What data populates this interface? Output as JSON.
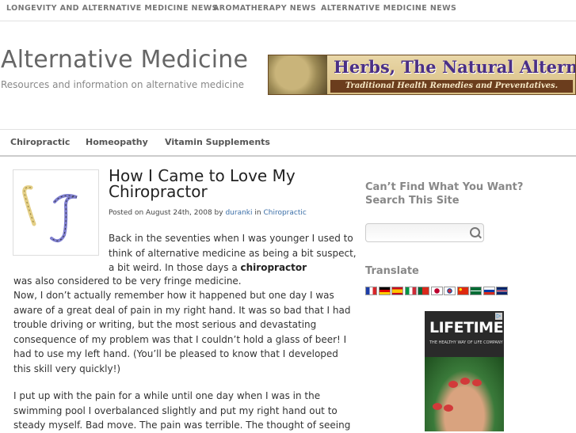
{
  "top_nav": [
    "LONGEVITY AND ALTERNATIVE MEDICINE NEWS",
    "AROMATHERAPY NEWS",
    "ALTERNATIVE MEDICINE NEWS"
  ],
  "site": {
    "title": "Alternative Medicine",
    "description": "Resources and information on alternative medicine"
  },
  "banner": {
    "title": "Herbs, The Natural Alternative",
    "subtitle": "Traditional Health Remedies and Preventatives."
  },
  "main_nav": [
    "Chiropractic",
    "Homeopathy",
    "Vitamin Supplements"
  ],
  "post": {
    "title": "How I Came to Love My Chiropractor",
    "meta_prefix": "Posted on August 24th, 2008 by ",
    "author": "duranki",
    "meta_in": " in ",
    "category": "Chiropractic",
    "p1_start": "Back in the seventies when I was younger I used to think of alternative medicine as being a bit suspect, a bit weird. In those days a ",
    "p1_bold": "chiropractor",
    "p1_end": " was also considered to be very fringe medicine.",
    "p2": "Now, I don’t actually remember how it happened but one day I was aware of a great deal of pain in my right hand. It was so bad that I had trouble driving or writing, but the most serious and devastating consequence of my problem was that I couldn’t hold a glass of beer! I had to use my left hand. (You’ll be pleased to know that I developed this skill very quickly!)",
    "p3": "I put up with the pain for a while until one day when I was in the swimming pool I overbalanced slightly and put my right hand out to steady myself. Bad move. The pain was terrible. The thought of seeing"
  },
  "sidebar": {
    "search_heading": "Can’t Find What You Want? Search This Site",
    "search_value": "",
    "translate_heading": "Translate",
    "flags": [
      "france-flag",
      "germany-flag",
      "spain-flag",
      "italy-flag",
      "portugal-flag",
      "japan-flag",
      "korea-flag",
      "china-flag",
      "saudi-flag",
      "russia-flag",
      "uk-flag"
    ]
  },
  "ad": {
    "title": "LIFETIME",
    "subtitle": "THE HEALTHY WAY OF LIFE COMPANY"
  },
  "colors": {
    "link": "#3b6fa8",
    "nav_text": "#777777",
    "sidebar_heading": "#888888"
  }
}
